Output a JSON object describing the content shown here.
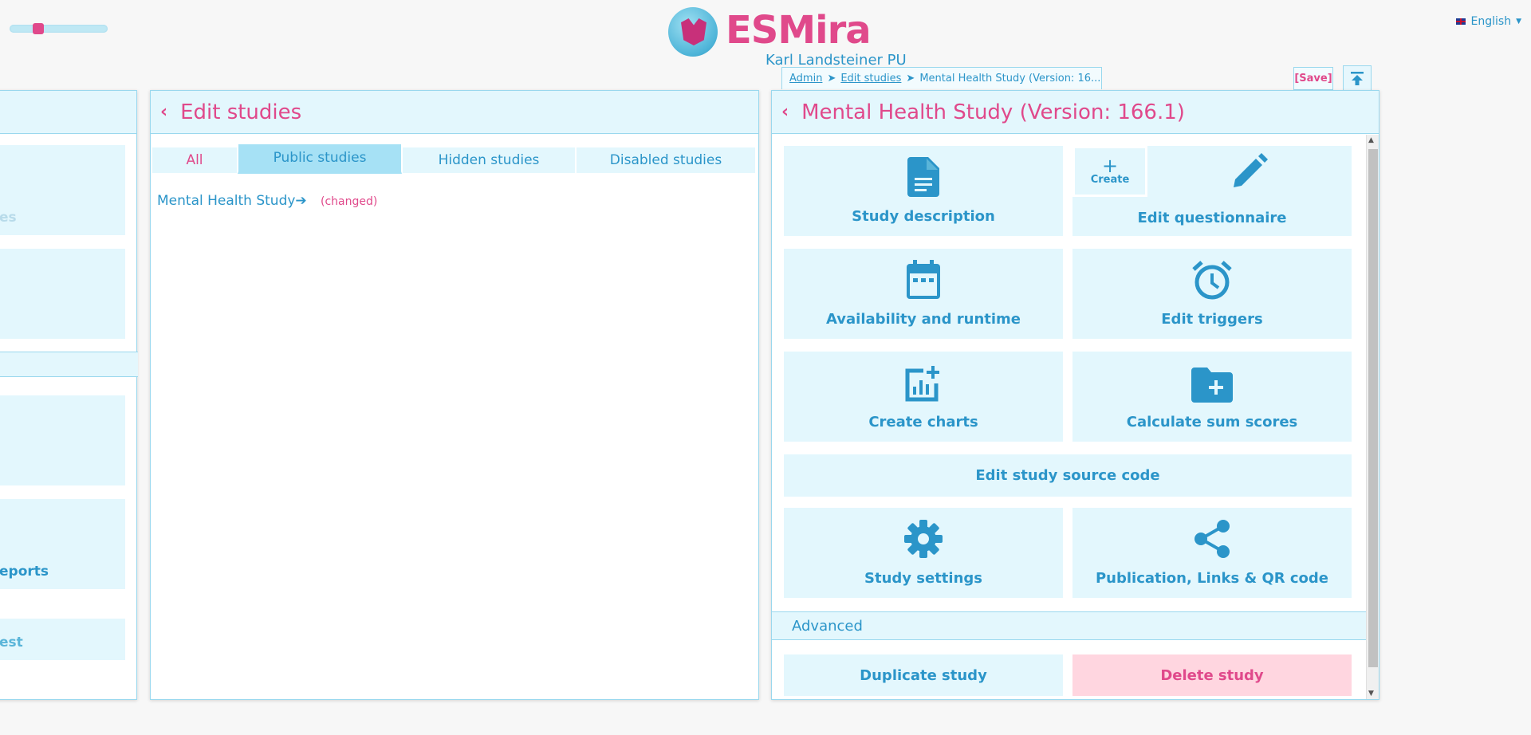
{
  "header": {
    "app_title": "ESMira",
    "institution": "Karl Landsteiner PU",
    "language": "English",
    "save_label": "[Save]"
  },
  "breadcrumb": {
    "items": [
      "Admin",
      "Edit studies",
      "Mental Health Study (Version: 16..."
    ],
    "separator": "➤"
  },
  "left_panel": {
    "card_fragments": [
      "es",
      "eports",
      "est"
    ]
  },
  "edit_studies": {
    "title": "Edit studies",
    "tabs": [
      "All",
      "Public studies",
      "Hidden studies",
      "Disabled studies"
    ],
    "active_tab": "Public studies",
    "studies": [
      {
        "name": "Mental Health Study➔",
        "status": "(changed)"
      }
    ]
  },
  "study_panel": {
    "title": "Mental Health Study (Version: 166.1)",
    "create_label": "Create",
    "cards": {
      "study_description": "Study description",
      "edit_questionnaire": "Edit questionnaire",
      "availability": "Availability and runtime",
      "edit_triggers": "Edit triggers",
      "create_charts": "Create charts",
      "sum_scores": "Calculate sum scores",
      "source_code": "Edit study source code",
      "study_settings": "Study settings",
      "publication": "Publication, Links & QR code"
    },
    "advanced_label": "Advanced",
    "duplicate_label": "Duplicate study",
    "delete_label": "Delete study"
  },
  "colors": {
    "accent_pink": "#e0498b",
    "accent_blue": "#2b95c9",
    "card_bg": "#e3f7fd",
    "danger_bg": "#ffd6e0"
  }
}
